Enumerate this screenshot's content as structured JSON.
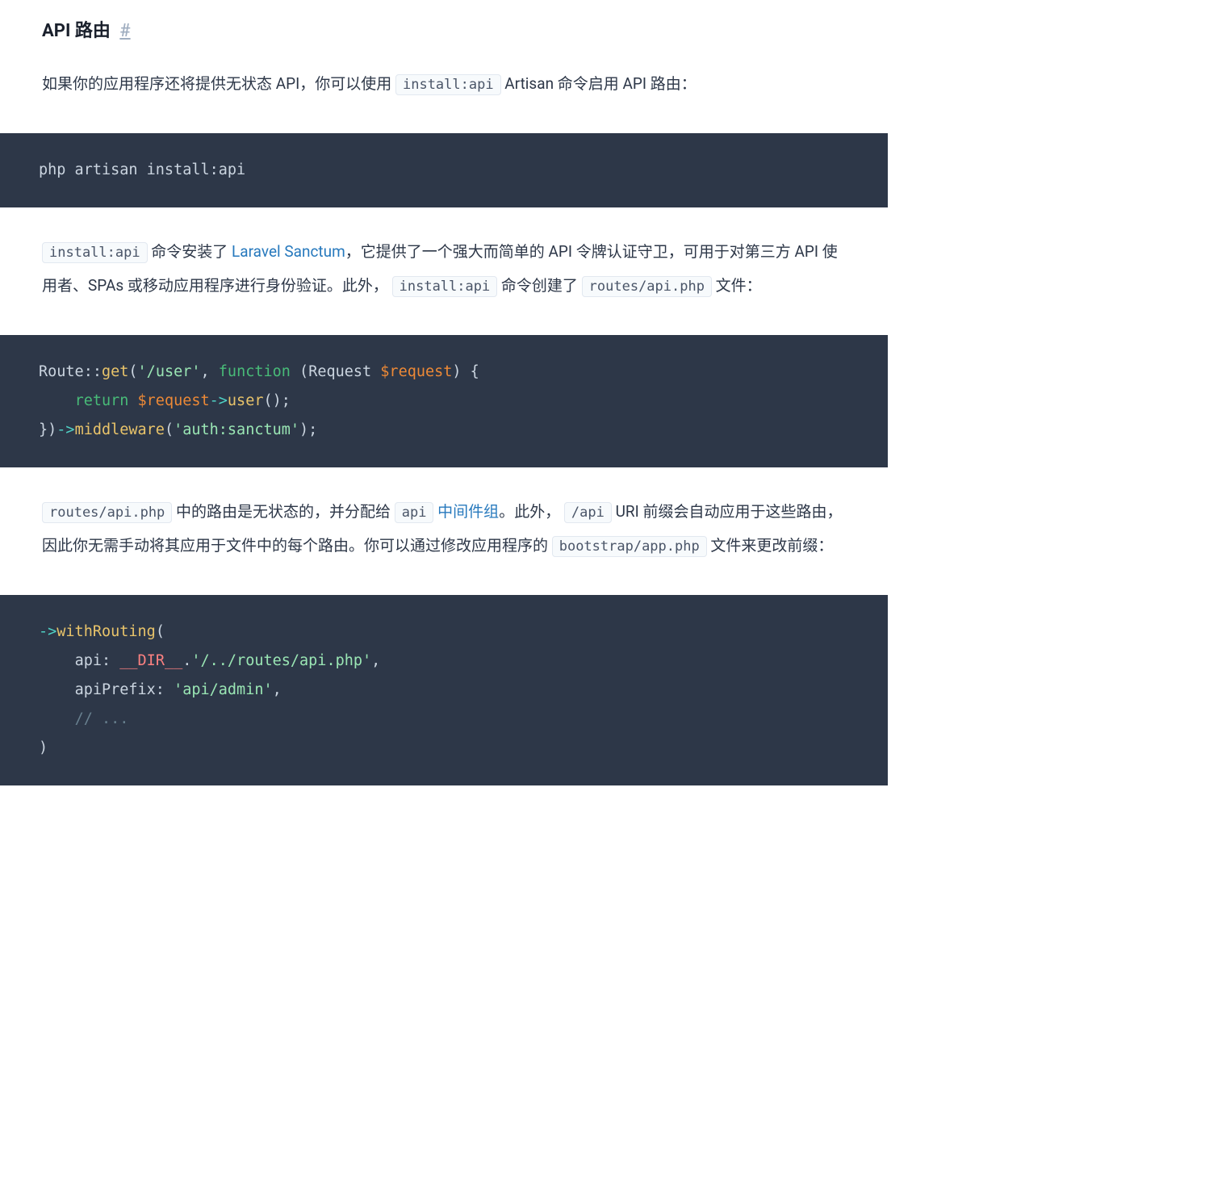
{
  "heading": {
    "title": "API 路由",
    "hash": "#"
  },
  "para1": {
    "pre": "如果你的应用程序还将提供无状态 API，你可以使用 ",
    "code": "install:api",
    "post": " Artisan 命令启用 API 路由："
  },
  "code1": {
    "line": "php artisan install:api"
  },
  "para2": {
    "code1": "install:api",
    "t1": " 命令安装了 ",
    "link": "Laravel Sanctum",
    "t2": "，它提供了一个强大而简单的 API 令牌认证守卫，可用于对第三方 API 使用者、SPAs 或移动应用程序进行身份验证。此外， ",
    "code2": "install:api",
    "t3": " 命令创建了 ",
    "code3": "routes/api.php",
    "t4": " 文件："
  },
  "code2": {
    "route": "Route",
    "dbl": "::",
    "get": "get",
    "lp1": "(",
    "str_user": "'/user'",
    "comma": ", ",
    "kw_function": "function",
    "sp": " ",
    "lp2": "(",
    "req_class": "Request ",
    "req_var": "$request",
    "rp2": ")",
    "brace_o": " {",
    "return_indent": "    ",
    "kw_return": "return",
    "sp2": " ",
    "req_var2": "$request",
    "arrow": "->",
    "user_fn": "user",
    "call": "();",
    "brace_c": "}",
    "rp1": ")",
    "arrow2": "->",
    "mw_fn": "middleware",
    "lp3": "(",
    "str_auth": "'auth:sanctum'",
    "rp3": ");"
  },
  "para3": {
    "code1": "routes/api.php",
    "t1": " 中的路由是无状态的，并分配给 ",
    "code2": "api",
    "t2": " ",
    "link": "中间件组",
    "t3": "。此外， ",
    "code3": "/api",
    "t4": " URI 前缀会自动应用于这些路由，因此你无需手动将其应用于文件中的每个路由。你可以通过修改应用程序的 ",
    "code4": "bootstrap/app.php",
    "t5": " 文件来更改前缀："
  },
  "code3": {
    "arrow": "->",
    "withRouting": "withRouting",
    "lp": "(",
    "indent": "    ",
    "api_key": "api: ",
    "dir_const": "__DIR__",
    "dot": ".",
    "api_path": "'/../routes/api.php'",
    "comma": ",",
    "prefix_key": "apiPrefix: ",
    "prefix_val": "'api/admin'",
    "comment": "// ...",
    "rp": ")"
  }
}
